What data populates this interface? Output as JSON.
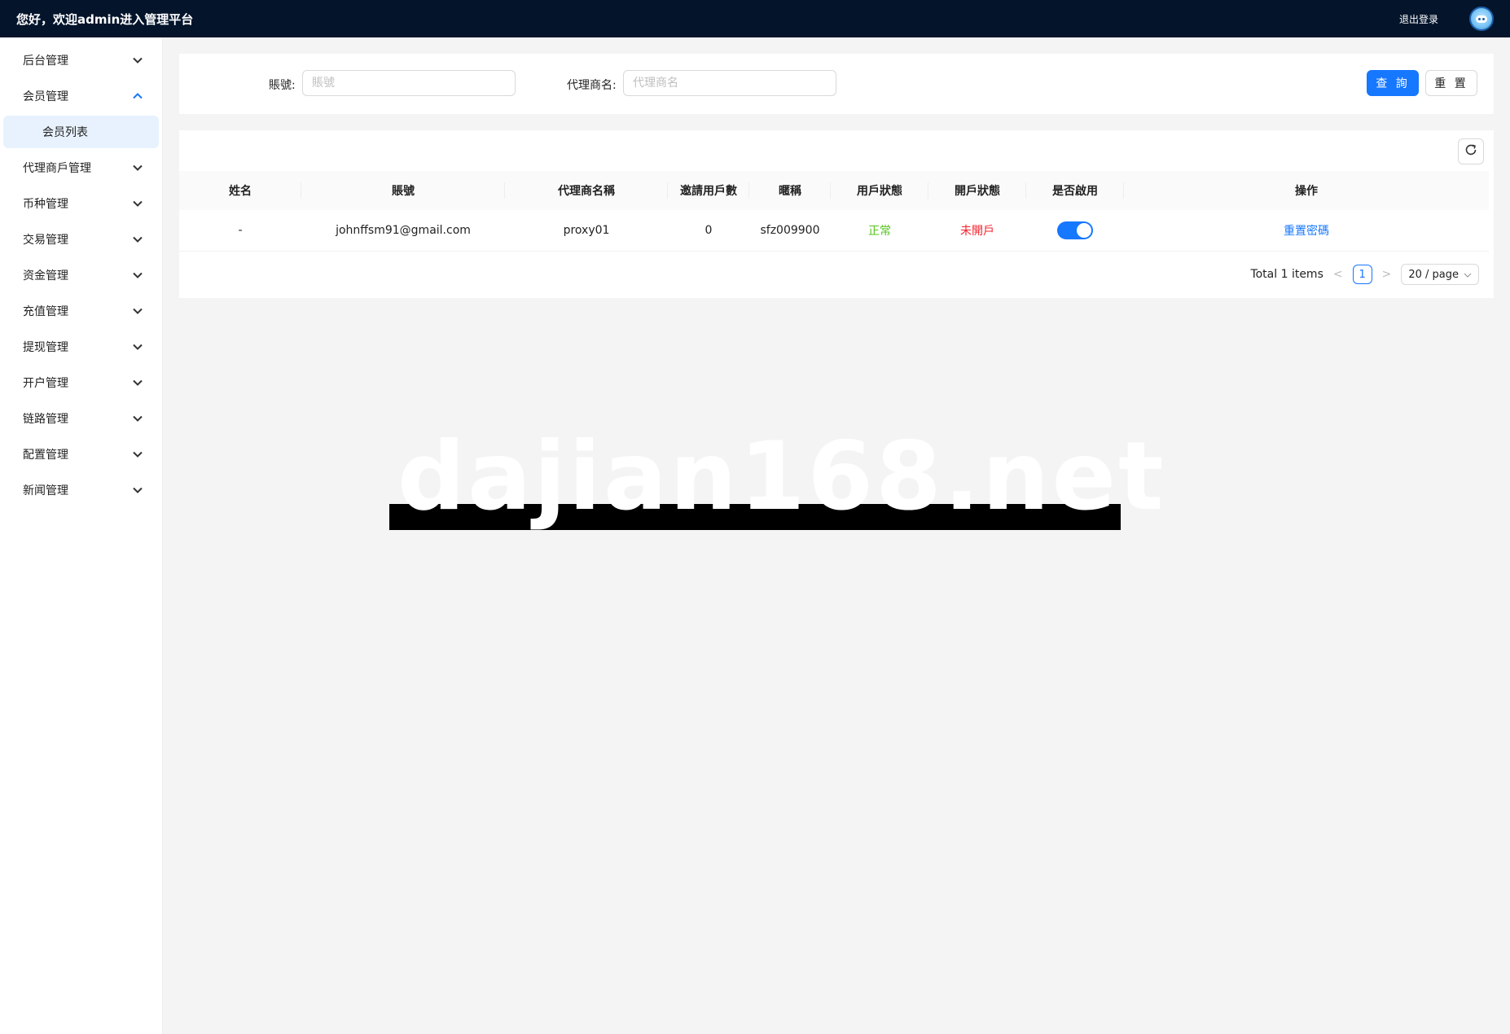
{
  "header": {
    "welcome": "您好，欢迎admin进入管理平台",
    "logout": "退出登录",
    "avatar_icon": "robot-avatar-icon"
  },
  "sidebar": {
    "items": [
      {
        "label": "后台管理",
        "expanded": false
      },
      {
        "label": "会员管理",
        "expanded": true,
        "children": [
          {
            "label": "会员列表",
            "active": true
          }
        ]
      },
      {
        "label": "代理商戶管理",
        "expanded": false
      },
      {
        "label": "币种管理",
        "expanded": false
      },
      {
        "label": "交易管理",
        "expanded": false
      },
      {
        "label": "资金管理",
        "expanded": false
      },
      {
        "label": "充值管理",
        "expanded": false
      },
      {
        "label": "提现管理",
        "expanded": false
      },
      {
        "label": "开户管理",
        "expanded": false
      },
      {
        "label": "链路管理",
        "expanded": false
      },
      {
        "label": "配置管理",
        "expanded": false
      },
      {
        "label": "新闻管理",
        "expanded": false
      }
    ]
  },
  "filters": {
    "account_label": "賬號:",
    "account_placeholder": "賬號",
    "account_value": "",
    "agent_label": "代理商名:",
    "agent_placeholder": "代理商名",
    "agent_value": "",
    "query_button": "查 詢",
    "reset_button": "重 置"
  },
  "table": {
    "columns": [
      "姓名",
      "賬號",
      "代理商名稱",
      "邀請用戶數",
      "暱稱",
      "用戶狀態",
      "開戶狀態",
      "是否啟用",
      "操作"
    ],
    "rows": [
      {
        "name": "-",
        "account": "johnffsm91@gmail.com",
        "agent": "proxy01",
        "invited": "0",
        "nickname": "sfz009900",
        "user_status": "正常",
        "account_status": "未開戶",
        "enabled": true,
        "action": "重置密碼"
      }
    ]
  },
  "pagination": {
    "total": "Total 1 items",
    "current_page": "1",
    "page_size": "20 / page"
  },
  "watermark": "dajian168.net",
  "colors": {
    "topbar": "#03142b",
    "primary": "#1677ff",
    "success": "#52c41a",
    "danger": "#f5222d"
  }
}
